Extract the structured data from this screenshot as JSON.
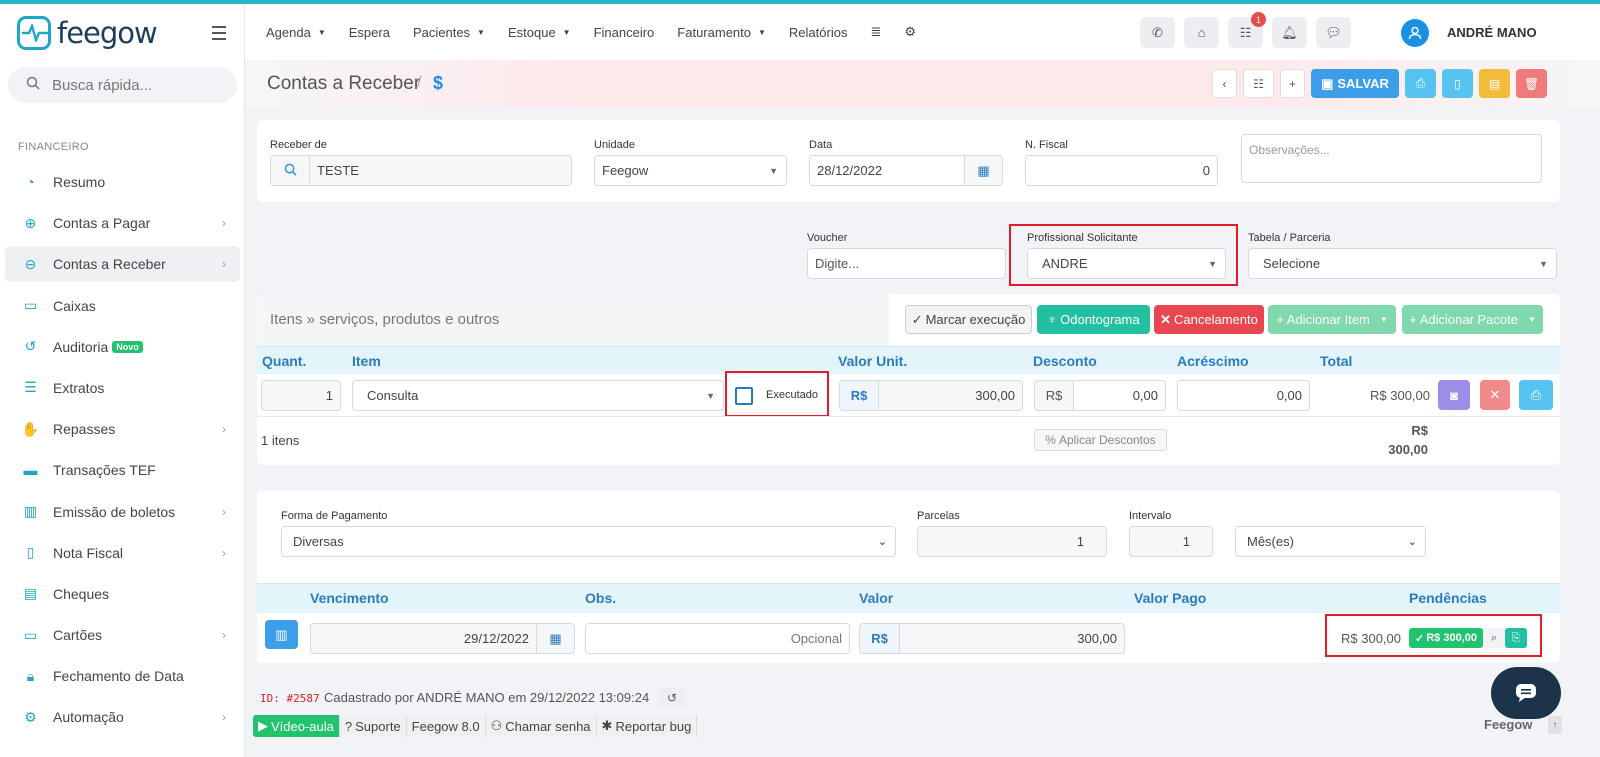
{
  "brand": {
    "name": "feegow"
  },
  "search": {
    "placeholder": "Busca rápida..."
  },
  "sidebar": {
    "section": "FINANCEIRO",
    "items": [
      {
        "label": "Resumo"
      },
      {
        "label": "Contas a Pagar"
      },
      {
        "label": "Contas a Receber"
      },
      {
        "label": "Caixas"
      },
      {
        "label": "Auditoria",
        "badge": "Novo"
      },
      {
        "label": "Extratos"
      },
      {
        "label": "Repasses"
      },
      {
        "label": "Transações TEF"
      },
      {
        "label": "Emissão de boletos"
      },
      {
        "label": "Nota Fiscal"
      },
      {
        "label": "Cheques"
      },
      {
        "label": "Cartões"
      },
      {
        "label": "Fechamento de Data"
      },
      {
        "label": "Automação"
      }
    ]
  },
  "nav": {
    "agenda": "Agenda",
    "espera": "Espera",
    "pacientes": "Pacientes",
    "estoque": "Estoque",
    "financeiro": "Financeiro",
    "faturamento": "Faturamento",
    "relatorios": "Relatórios"
  },
  "topbar": {
    "notif_count": "1",
    "user_name": "ANDRÉ MANO"
  },
  "page": {
    "title": "Contas a Receber",
    "separator": "/",
    "currency_symbol": "$",
    "save_label": "SALVAR"
  },
  "form": {
    "receber_de_label": "Receber de",
    "receber_de_value": "TESTE",
    "unidade_label": "Unidade",
    "unidade_value": "Feegow",
    "data_label": "Data",
    "data_value": "28/12/2022",
    "nfiscal_label": "N. Fiscal",
    "nfiscal_value": "0",
    "obs_placeholder": "Observações...",
    "voucher_label": "Voucher",
    "voucher_placeholder": "Digite...",
    "profissional_label": "Profissional Solicitante",
    "profissional_value": "ANDRE",
    "tabela_label": "Tabela / Parceria",
    "tabela_value": "Selecione"
  },
  "items": {
    "section_title": "Itens » serviços, produtos e outros",
    "buttons": {
      "marcar": "Marcar execução",
      "odonto": "Odontograma",
      "cancel": "Cancelamento",
      "add_item": "Adicionar Item",
      "add_pacote": "Adicionar Pacote"
    },
    "headers": {
      "quant": "Quant.",
      "item": "Item",
      "valor_unit": "Valor Unit.",
      "desconto": "Desconto",
      "acrescimo": "Acréscimo",
      "total": "Total"
    },
    "row": {
      "quant": "1",
      "item": "Consulta",
      "executado": "Executado",
      "currency": "R$",
      "valor_unit": "300,00",
      "desconto": "0,00",
      "acrescimo": "0,00",
      "total": "R$ 300,00"
    },
    "count": "1 itens",
    "aplicar": "Aplicar Descontos",
    "sum_currency": "R$",
    "sum_value": "300,00"
  },
  "payment": {
    "forma_label": "Forma de Pagamento",
    "forma_value": "Diversas",
    "parcelas_label": "Parcelas",
    "parcelas_value": "1",
    "intervalo_label": "Intervalo",
    "intervalo_value": "1",
    "periodo_value": "Mês(es)",
    "headers": {
      "vencimento": "Vencimento",
      "obs": "Obs.",
      "valor": "Valor",
      "valor_pago": "Valor Pago",
      "pendencias": "Pendências"
    },
    "row": {
      "vencimento": "29/12/2022",
      "obs_placeholder": "Opcional",
      "currency": "R$",
      "valor": "300,00",
      "pend_value": "R$ 300,00",
      "pend_badge": "R$ 300,00"
    }
  },
  "meta": {
    "id": "ID: #2587",
    "created": "Cadastrado por ANDRÉ MANO em 29/12/2022 13:09:24"
  },
  "footer": {
    "video": "Vídeo-aula",
    "suporte": "Suporte",
    "version": "Feegow 8.0",
    "chamar": "Chamar senha",
    "bug": "Reportar bug",
    "brand": "Feegow"
  }
}
